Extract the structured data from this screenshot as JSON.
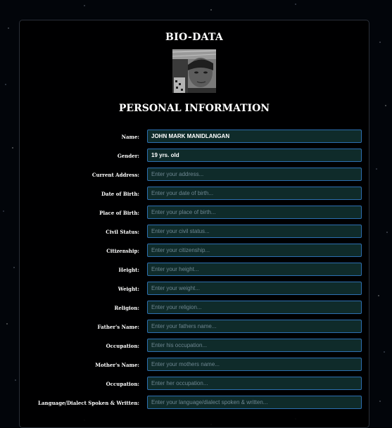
{
  "header": {
    "title": "BIO-DATA"
  },
  "profile": {
    "photo": "profile-photo"
  },
  "section": {
    "title": "PERSONAL INFORMATION"
  },
  "fields": [
    {
      "label": "Name:",
      "value": "JOHN MARK MANIDLANGAN",
      "placeholder": ""
    },
    {
      "label": "Gender:",
      "value": "19 yrs. old",
      "placeholder": ""
    },
    {
      "label": "Current Address:",
      "value": "",
      "placeholder": "Enter your address..."
    },
    {
      "label": "Date of Birth:",
      "value": "",
      "placeholder": "Enter your date of birth..."
    },
    {
      "label": "Place of Birth:",
      "value": "",
      "placeholder": "Enter your place of birth..."
    },
    {
      "label": "Civil Status:",
      "value": "",
      "placeholder": "Enter your civil status..."
    },
    {
      "label": "Citizenship:",
      "value": "",
      "placeholder": "Enter your citizenship..."
    },
    {
      "label": "Height:",
      "value": "",
      "placeholder": "Enter your height..."
    },
    {
      "label": "Weight:",
      "value": "",
      "placeholder": "Enter your weight..."
    },
    {
      "label": "Religion:",
      "value": "",
      "placeholder": "Enter your religion..."
    },
    {
      "label": "Father's Name:",
      "value": "",
      "placeholder": "Enter your fathers name..."
    },
    {
      "label": "Occupation:",
      "value": "",
      "placeholder": "Enter his occupation..."
    },
    {
      "label": "Mother's Name:",
      "value": "",
      "placeholder": "Enter your mothers name..."
    },
    {
      "label": "Occupation:",
      "value": "",
      "placeholder": "Enter her occupation..."
    },
    {
      "label": "Language/Dialect Spoken & Written:",
      "value": "",
      "placeholder": "Enter your language/dialect spoken & written..."
    }
  ],
  "colors": {
    "field_bg": "#0f2b2a",
    "field_border": "#2d6fb0",
    "card_bg": "#000000"
  }
}
